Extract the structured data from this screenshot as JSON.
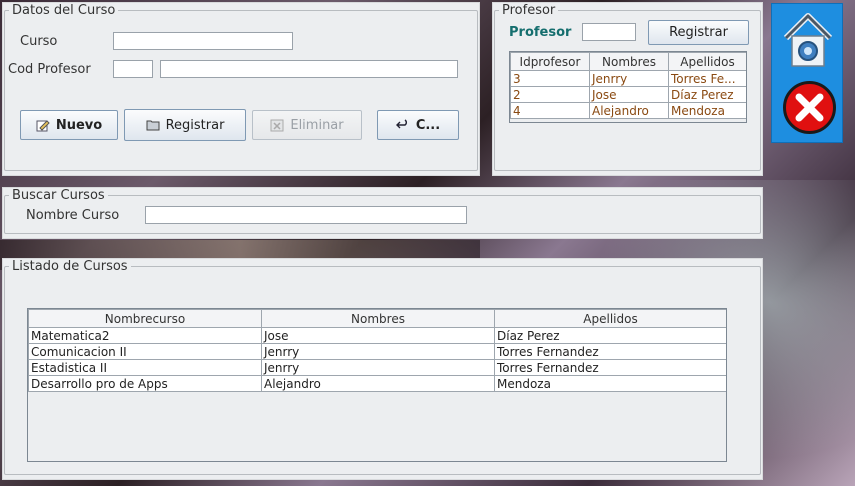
{
  "curso_panel": {
    "legend": "Datos del Curso",
    "curso_label": "Curso",
    "curso_value": "",
    "codprof_label": "Cod Profesor",
    "codprof_value": "",
    "profname_value": "",
    "buttons": {
      "nuevo": "Nuevo",
      "registrar": "Registrar",
      "eliminar": "Eliminar",
      "cancelar": "C..."
    }
  },
  "profesor_panel": {
    "legend": "Profesor",
    "label": "Profesor",
    "input_value": "",
    "registrar": "Registrar",
    "columns": [
      "Idprofesor",
      "Nombres",
      "Apellidos"
    ],
    "rows": [
      [
        "3",
        "Jenrry",
        "Torres Fe..."
      ],
      [
        "2",
        "Jose",
        "Díaz Perez"
      ],
      [
        "4",
        "Alejandro",
        "Mendoza"
      ]
    ]
  },
  "buscar_panel": {
    "legend": "Buscar Cursos",
    "label": "Nombre Curso",
    "value": ""
  },
  "listado_panel": {
    "legend": "Listado de Cursos",
    "columns": [
      "Nombrecurso",
      "Nombres",
      "Apellidos"
    ],
    "rows": [
      [
        "Matematica2",
        "Jose",
        "Díaz Perez"
      ],
      [
        "Comunicacion II",
        "Jenrry",
        "Torres Fernandez"
      ],
      [
        "Estadistica II",
        "Jenrry",
        "Torres Fernandez"
      ],
      [
        "Desarrollo pro de Apps",
        "Alejandro",
        "Mendoza"
      ]
    ]
  },
  "side_buttons": {
    "home_icon": "home-icon",
    "close_icon": "close-icon"
  },
  "colors": {
    "accent_teal": "#156e6e",
    "cell_text_brown": "#8a4a12",
    "side_panel_blue": "#1e8ee0",
    "close_red": "#e01010"
  }
}
